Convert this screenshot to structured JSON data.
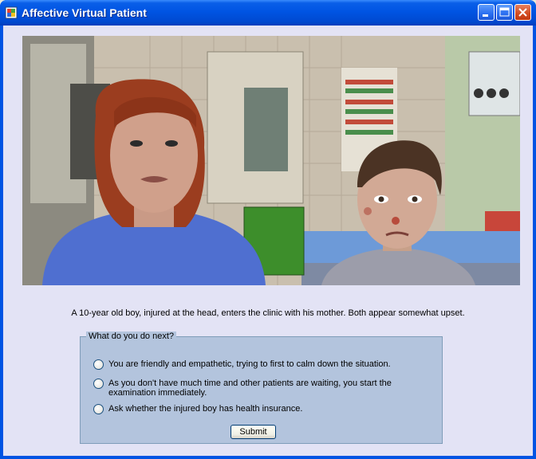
{
  "window": {
    "title": "Affective Virtual Patient",
    "app_icon": "windows-app-icon",
    "controls": [
      "minimize-icon",
      "maximize-icon",
      "close-icon"
    ]
  },
  "scene": {
    "image": "clinic scene with mother and injured boy avatars"
  },
  "scenario_text": "A 10-year old boy, injured at the head, enters the clinic with his mother. Both appear somewhat upset.",
  "question_group": {
    "legend": "What do you do next?",
    "options": [
      "You are friendly and empathetic, trying to first to calm down the situation.",
      "As you don't have much time and other patients are waiting, you start the examination immediately.",
      "Ask whether the injured boy has health insurance."
    ],
    "selected": null
  },
  "submit_label": "Submit",
  "colors": {
    "titlebar": "#0054e3",
    "client_bg": "#e3e3f5",
    "group_bg": "#b3c4dd"
  }
}
